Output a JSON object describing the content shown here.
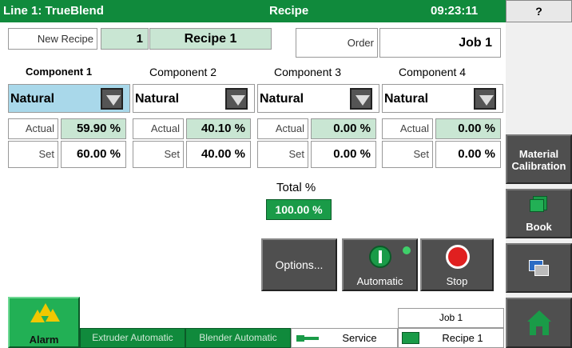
{
  "header": {
    "line_title": "Line 1: TrueBlend",
    "screen_title": "Recipe",
    "time": "09:23:11",
    "help_label": "?"
  },
  "recipe": {
    "new_recipe_label": "New Recipe",
    "recipe_number": "1",
    "recipe_name": "Recipe 1",
    "order_label": "Order",
    "order_value": "Job 1"
  },
  "components": [
    {
      "title": "Component 1",
      "material": "Natural",
      "actual_label": "Actual",
      "actual": "59.90 %",
      "set_label": "Set",
      "set": "60.00 %"
    },
    {
      "title": "Component 2",
      "material": "Natural",
      "actual_label": "Actual",
      "actual": "40.10 %",
      "set_label": "Set",
      "set": "40.00 %"
    },
    {
      "title": "Component 3",
      "material": "Natural",
      "actual_label": "Actual",
      "actual": "0.00 %",
      "set_label": "Set",
      "set": "0.00 %"
    },
    {
      "title": "Component 4",
      "material": "Natural",
      "actual_label": "Actual",
      "actual": "0.00 %",
      "set_label": "Set",
      "set": "0.00 %"
    }
  ],
  "total": {
    "label": "Total %",
    "value": "100.00 %"
  },
  "controls": {
    "options_label": "Options...",
    "automatic_label": "Automatic",
    "stop_label": "Stop"
  },
  "sidebar": {
    "material_calibration_label": "Material\nCalibration",
    "book_label": "Book"
  },
  "status": {
    "alarm_label": "Alarm",
    "extruder": "Extruder Automatic",
    "blender": "Blender Automatic",
    "service": "Service",
    "job": "Job 1",
    "recipe": "Recipe 1"
  },
  "colors": {
    "title_green": "#108a3c",
    "highlight_green": "#c9e6d3",
    "total_green": "#1a9b48",
    "selected_blue": "#a9d8ea",
    "button_dark": "#4f4f4f"
  },
  "icons": {
    "alarm": "warning-triangles-icon",
    "automatic": "power-toggle-icon",
    "stop": "stop-circle-icon",
    "book": "book-stack-icon",
    "transfer": "window-transfer-icon",
    "home": "home-icon",
    "service": "key-icon",
    "recipe": "folder-icon"
  }
}
